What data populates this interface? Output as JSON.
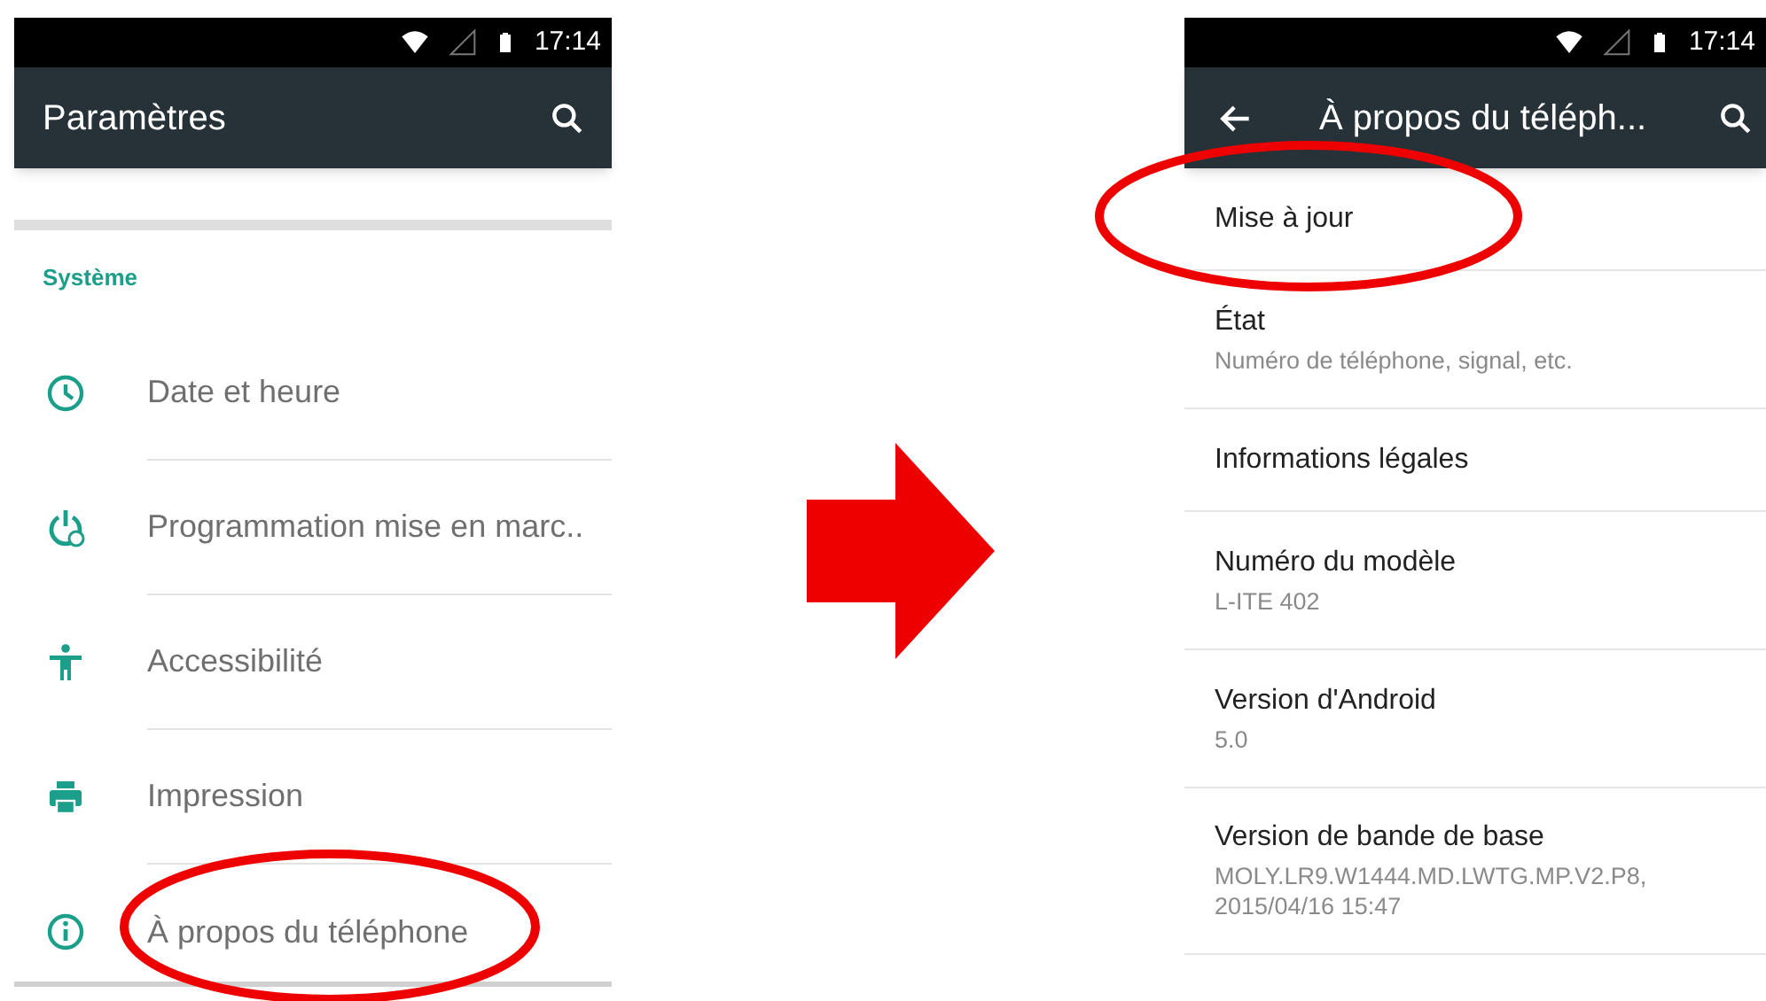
{
  "left_screen": {
    "status_bar": {
      "time": "17:14"
    },
    "toolbar": {
      "title": "Paramètres"
    },
    "section_header": "Système",
    "items": [
      {
        "kind": "clock",
        "label": "Date et heure"
      },
      {
        "kind": "power-clock",
        "label": "Programmation mise en marc.."
      },
      {
        "kind": "accessibility",
        "label": "Accessibilité"
      },
      {
        "kind": "printer",
        "label": "Impression"
      },
      {
        "kind": "info",
        "label": "À propos du téléphone"
      }
    ]
  },
  "right_screen": {
    "status_bar": {
      "time": "17:14"
    },
    "toolbar": {
      "title": "À propos du téléph..."
    },
    "items": [
      {
        "title": "Mise à jour"
      },
      {
        "title": "État",
        "summary": "Numéro de téléphone, signal, etc."
      },
      {
        "title": "Informations légales"
      },
      {
        "title": "Numéro du modèle",
        "summary": "L-ITE 402"
      },
      {
        "title": "Version d'Android",
        "summary": "5.0"
      },
      {
        "title": "Version de bande de base",
        "summary": "MOLY.LR9.W1444.MD.LWTG.MP.V2.P8,\n2015/04/16 15:47"
      }
    ]
  }
}
